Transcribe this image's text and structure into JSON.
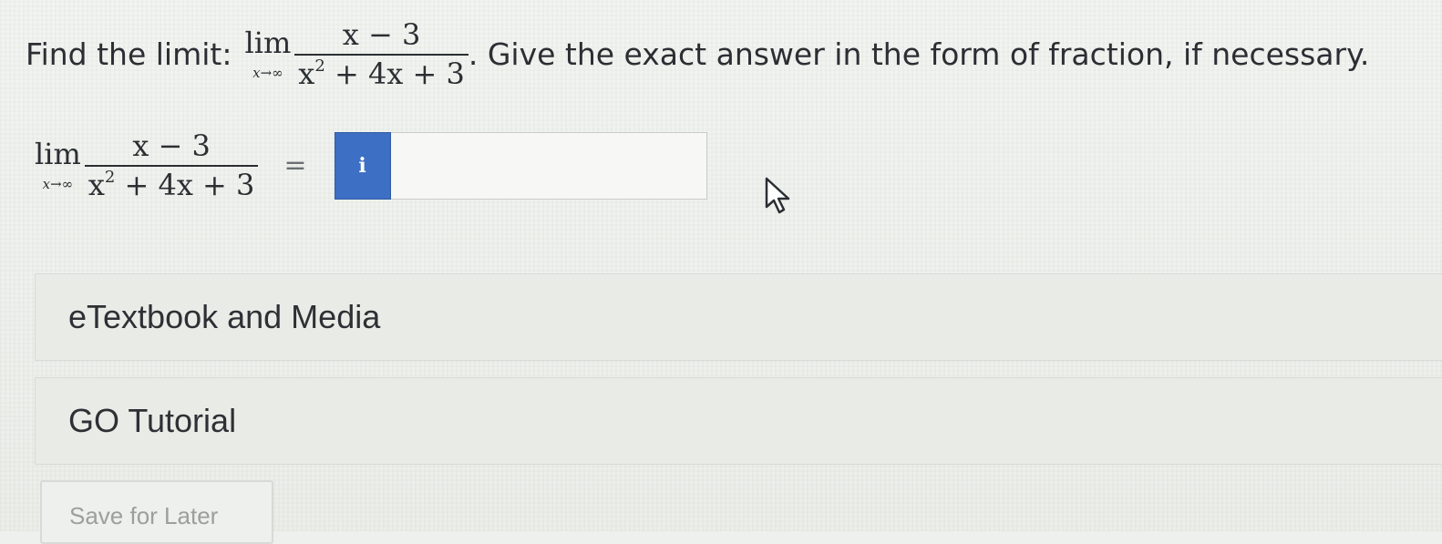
{
  "question": {
    "prefix": "Find the limit:",
    "lim": "lim",
    "lim_subscript": "x→∞",
    "numerator": "x − 3",
    "denominator_base": "x",
    "denominator_exponent": "2",
    "denominator_rest": " + 4x + 3",
    "suffix": ". Give the exact answer in the form of fraction, if necessary."
  },
  "answer": {
    "lim": "lim",
    "lim_subscript": "x→∞",
    "numerator": "x − 3",
    "denominator_base": "x",
    "denominator_exponent": "2",
    "denominator_rest": " + 4x + 3",
    "equals": "=",
    "info_button_label": "i",
    "input_value": "",
    "input_placeholder": ""
  },
  "panels": {
    "etextbook_label": "eTextbook and Media",
    "tutorial_label": "GO Tutorial"
  },
  "buttons": {
    "save_for_later": "Save for Later"
  },
  "colors": {
    "info_button": "#3d6fc4",
    "background": "#eef0ed"
  },
  "icons": {
    "cursor": "mouse-pointer-icon"
  }
}
